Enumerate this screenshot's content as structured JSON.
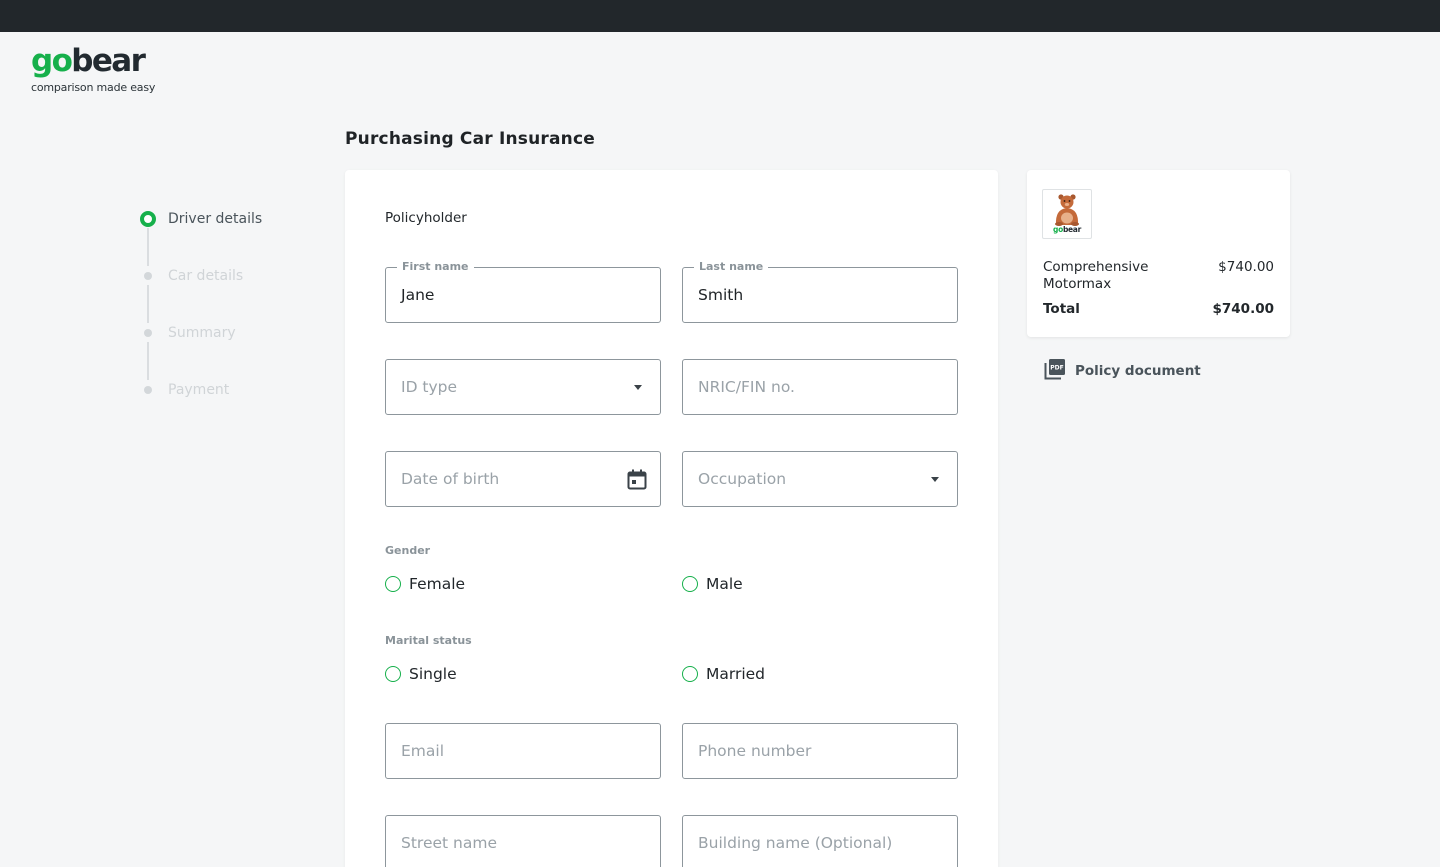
{
  "brand": {
    "go": "go",
    "bear": "bear",
    "tagline": "comparison made easy",
    "accent": "#16b04b"
  },
  "page": {
    "title": "Purchasing Car Insurance"
  },
  "stepper": {
    "steps": [
      {
        "label": "Driver details",
        "state": "active"
      },
      {
        "label": "Car details",
        "state": "inactive"
      },
      {
        "label": "Summary",
        "state": "inactive"
      },
      {
        "label": "Payment",
        "state": "inactive"
      }
    ]
  },
  "form": {
    "section_title": "Policyholder",
    "first_name": {
      "label": "First name",
      "value": "Jane"
    },
    "last_name": {
      "label": "Last name",
      "value": "Smith"
    },
    "id_type": {
      "placeholder": "ID type",
      "icon": "chevron-down-icon"
    },
    "nric": {
      "placeholder": "NRIC/FIN no."
    },
    "dob": {
      "placeholder": "Date of birth",
      "icon": "calendar-icon"
    },
    "occupation": {
      "placeholder": "Occupation",
      "icon": "chevron-down-icon"
    },
    "gender": {
      "label": "Gender",
      "options": [
        "Female",
        "Male"
      ]
    },
    "marital": {
      "label": "Marital status",
      "options": [
        "Single",
        "Married"
      ]
    },
    "email": {
      "placeholder": "Email"
    },
    "phone": {
      "placeholder": "Phone number"
    },
    "street": {
      "placeholder": "Street name"
    },
    "building": {
      "placeholder": "Building name (Optional)"
    }
  },
  "summary": {
    "insurer_logo": {
      "go": "go",
      "bear": "bear"
    },
    "plan_name": "Comprehensive Motormax",
    "plan_price": "$740.00",
    "total_label": "Total",
    "total_price": "$740.00"
  },
  "policy_doc": {
    "label": "Policy document",
    "icon": "pdf-icon"
  }
}
